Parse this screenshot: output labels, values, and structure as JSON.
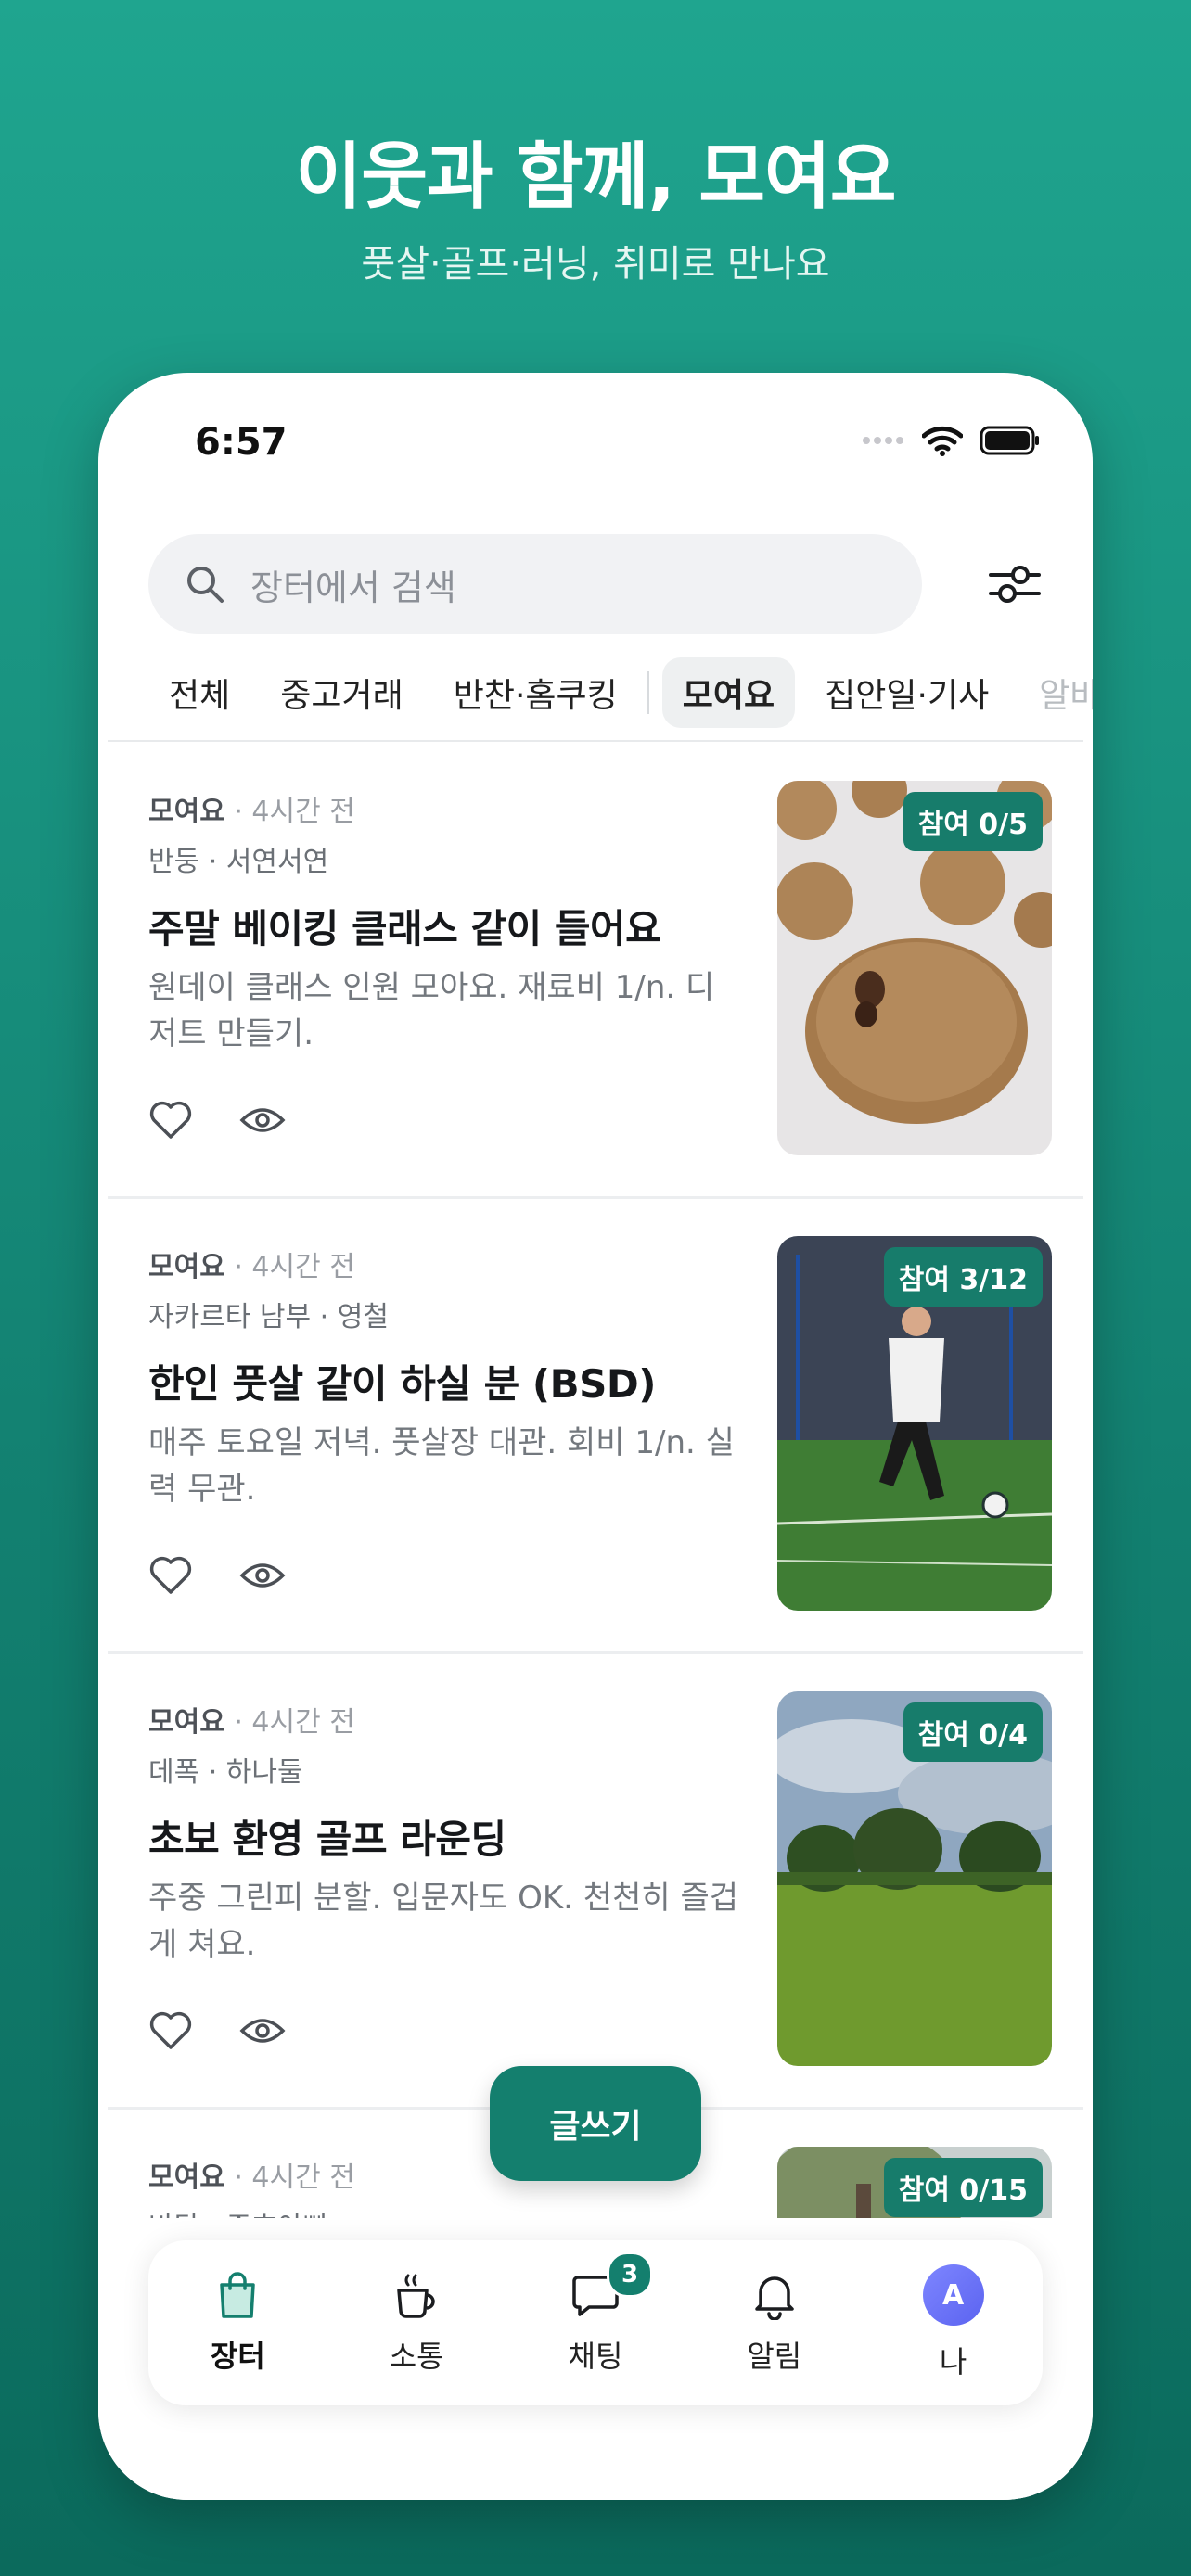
{
  "promo": {
    "title": "이웃과 함께, 모여요",
    "subtitle": "풋살·골프·러닝, 취미로 만나요"
  },
  "status_bar": {
    "time": "6:57"
  },
  "search": {
    "placeholder": "장터에서 검색"
  },
  "categories": [
    {
      "label": "전체"
    },
    {
      "label": "중고거래"
    },
    {
      "label": "반찬·홈쿠킹"
    },
    {
      "label": "모여요"
    },
    {
      "label": "집안일·기사"
    },
    {
      "label": "알바"
    }
  ],
  "posts": [
    {
      "category": "모여요",
      "time": " · 4시간 전",
      "location": "반둥 · 서연서연",
      "title": "주말 베이킹 클래스 같이 들어요",
      "description": "원데이 클래스 인원 모아요. 재료비 1/n. 디저트 만들기.",
      "badge": "참여 0/5",
      "image": "cookies-photo"
    },
    {
      "category": "모여요",
      "time": " · 4시간 전",
      "location": "자카르타 남부 · 영철",
      "title": "한인 풋살 같이 하실 분 (BSD)",
      "description": "매주 토요일 저녁. 풋살장 대관. 회비 1/n. 실력 무관.",
      "badge": "참여 3/12",
      "image": "futsal-photo"
    },
    {
      "category": "모여요",
      "time": " · 4시간 전",
      "location": "데폭 · 하나둘",
      "title": "초보 환영 골프 라운딩",
      "description": "주중 그린피 분할. 입문자도 OK. 천천히 즐겁게 쳐요.",
      "badge": "참여 0/4",
      "image": "golf-course-photo"
    },
    {
      "category": "모여요",
      "time": " · 4시간 전",
      "location": "바탐 · 준호아빠",
      "title": "",
      "description": "",
      "badge": "참여 0/15",
      "image": "tree-photo"
    }
  ],
  "fab": {
    "label": "글쓰기"
  },
  "tabbar": {
    "items": [
      {
        "label": "장터",
        "icon": "shopping-bag-icon"
      },
      {
        "label": "소통",
        "icon": "coffee-cup-icon"
      },
      {
        "label": "채팅",
        "icon": "chat-bubble-icon",
        "badge": "3"
      },
      {
        "label": "알림",
        "icon": "bell-icon"
      },
      {
        "label": "나",
        "icon": "avatar",
        "avatar_letter": "A"
      }
    ]
  },
  "colors": {
    "accent": "#147f6e",
    "background_top": "#1fa58f",
    "background_bottom": "#0b6a5c"
  }
}
